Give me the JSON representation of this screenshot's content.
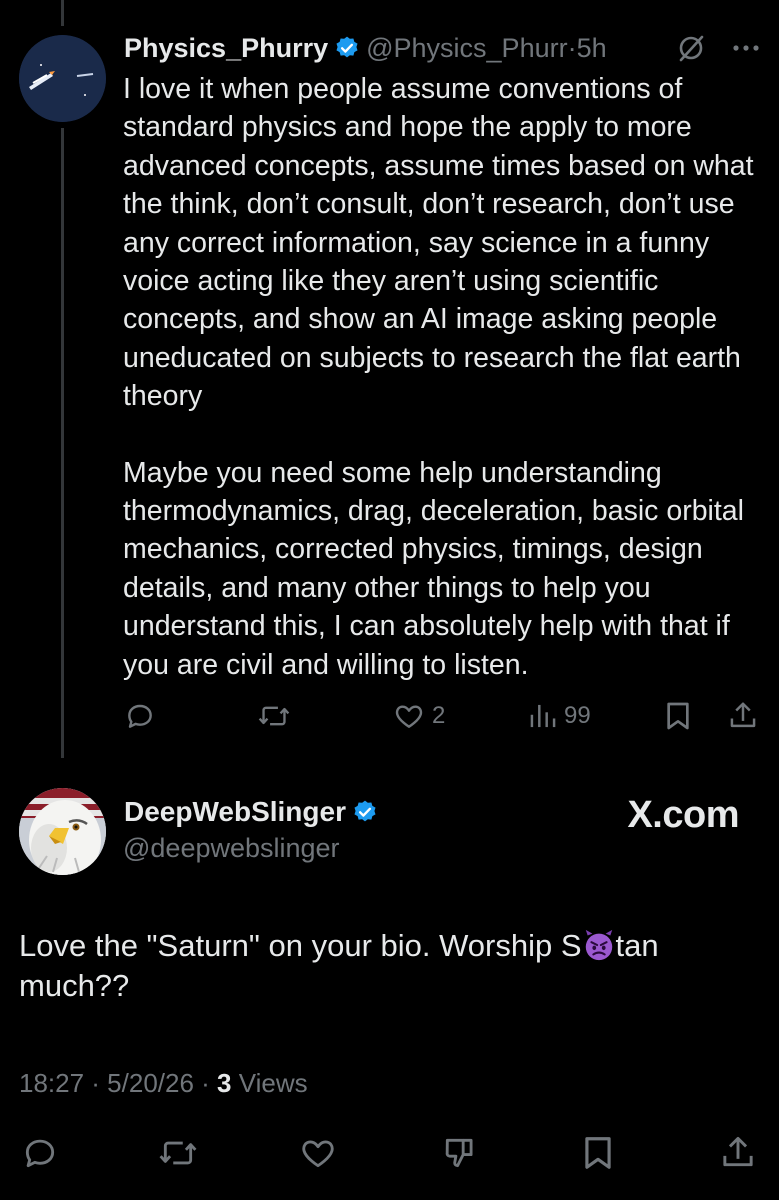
{
  "tweet1": {
    "display_name": "Physics_Phurry",
    "handle": "@Physics_Phurr",
    "separator": "·",
    "time": "5h",
    "body_paragraphs": [
      "I love it when people assume conventions of standard physics and hope the apply to more advanced concepts, assume times based on what the think, don’t consult, don’t research, don’t use any correct information, say science in a funny voice acting like they aren’t using scientific concepts, and show an AI image asking people uneducated on subjects to research the flat earth theory",
      "Maybe you need some help understanding thermodynamics, drag, deceleration, basic orbital mechanics, corrected physics, timings, design details, and many other things to help you understand this, I can absolutely help with that if you are civil and willing to listen."
    ],
    "likes": "2",
    "views": "99"
  },
  "tweet2": {
    "display_name": "DeepWebSlinger",
    "handle": "@deepwebslinger",
    "watermark": "X.com",
    "text_before_emoji": "Love the \"Saturn\" on your bio. Worship S",
    "text_after_emoji": "tan much??",
    "emoji": "smiling-imp-emoji",
    "timestamp": "18:27 · 5/20/26 · ",
    "views_count": "3",
    "views_label": " Views"
  },
  "colors": {
    "background": "#000000",
    "text": "#e7e9ea",
    "muted": "#71767b",
    "verified": "#1d9bf0",
    "thread_line": "#333639"
  }
}
